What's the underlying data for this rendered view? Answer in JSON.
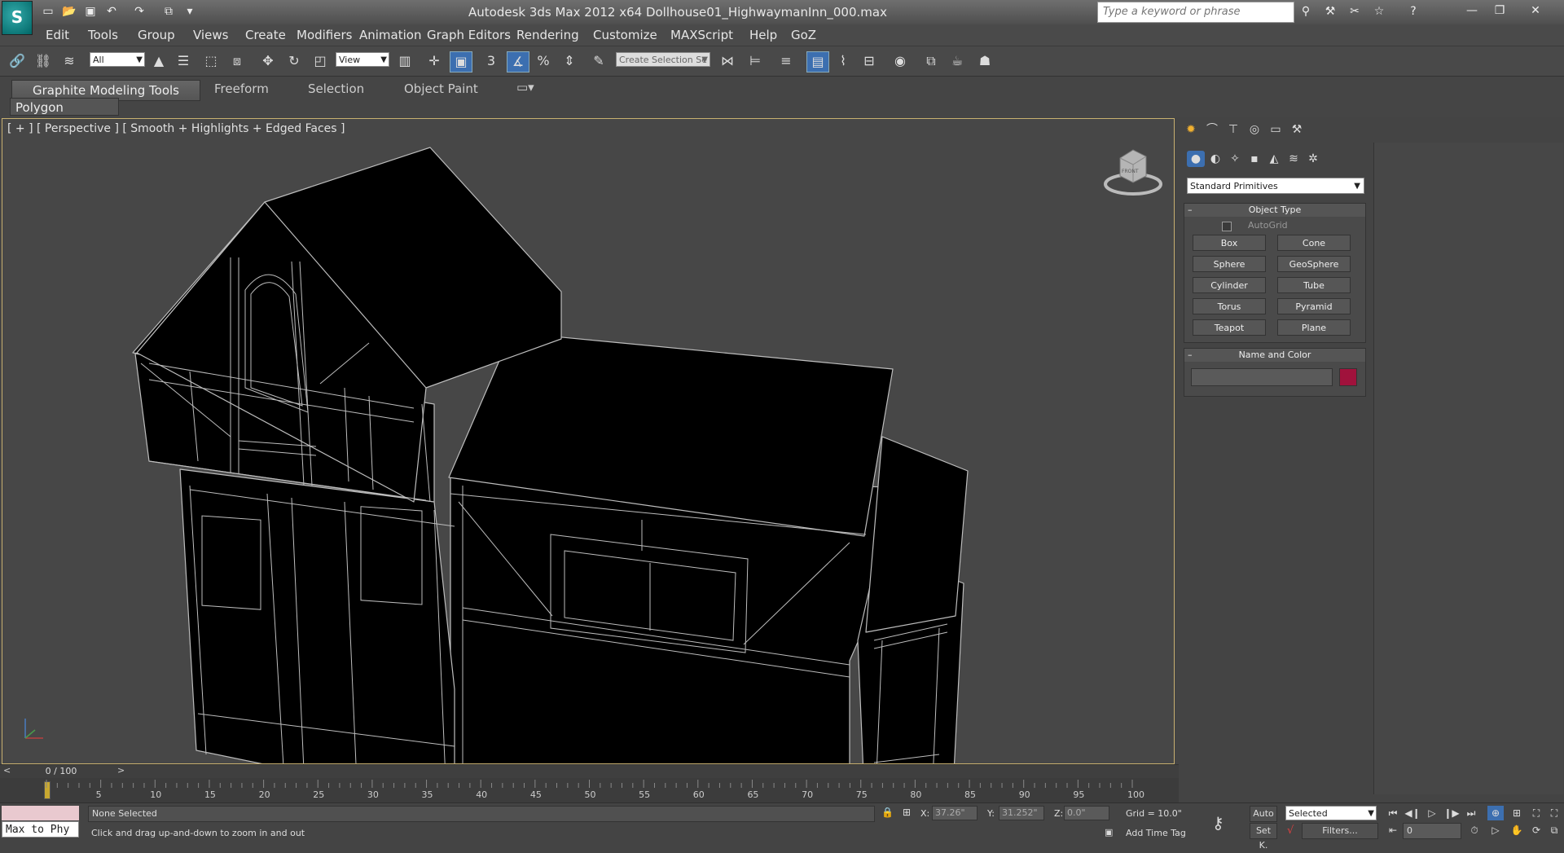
{
  "app": {
    "title": "Autodesk 3ds Max  2012 x64     Dollhouse01_HighwaymanInn_000.max",
    "logo": "S"
  },
  "search": {
    "placeholder": "Type a keyword or phrase"
  },
  "menu": [
    "Edit",
    "Tools",
    "Group",
    "Views",
    "Create",
    "Modifiers",
    "Animation",
    "Graph Editors",
    "Rendering",
    "Customize",
    "MAXScript",
    "Help",
    "GoZ"
  ],
  "toolbar": {
    "filter_value": "All",
    "refcoord_value": "View",
    "selection_set_placeholder": "Create Selection Se",
    "snap_3d": "3",
    "snap_percent": "%"
  },
  "ribbon": {
    "tabs": [
      "Graphite Modeling Tools",
      "Freeform",
      "Selection",
      "Object Paint"
    ],
    "polygon_modeling": "Polygon Modeling"
  },
  "viewport": {
    "label": "[ + ] [ Perspective ] [ Smooth + Highlights + Edged Faces ]",
    "viewcube_face": "FRONT"
  },
  "command_panel": {
    "category": "Standard Primitives",
    "object_type": {
      "title": "Object Type",
      "autogrid": "AutoGrid",
      "buttons": [
        "Box",
        "Cone",
        "Sphere",
        "GeoSphere",
        "Cylinder",
        "Tube",
        "Torus",
        "Pyramid",
        "Teapot",
        "Plane"
      ]
    },
    "name_and_color": {
      "title": "Name and Color",
      "name_value": "",
      "color": "#a0123c"
    }
  },
  "timeline": {
    "frame_counter": "0 / 100",
    "ticks": [
      "5",
      "10",
      "15",
      "20",
      "25",
      "30",
      "35",
      "40",
      "45",
      "50",
      "55",
      "60",
      "65",
      "70",
      "75",
      "80",
      "85",
      "90",
      "95",
      "100"
    ]
  },
  "status": {
    "maxscript_text": "Max to Phy",
    "selection": "None Selected",
    "prompt": "Click and drag up-and-down to zoom in and out",
    "x_label": "X:",
    "x_value": "37.26\"",
    "y_label": "Y:",
    "y_value": "31.252\"",
    "z_label": "Z:",
    "z_value": "0.0\"",
    "grid": "Grid = 10.0\"",
    "add_time_tag": "Add Time Tag",
    "auto_key": "Auto",
    "set_key": "Set K.",
    "key_filter": "Selected",
    "filters": "Filters...",
    "current_frame": "0"
  },
  "colors": {
    "accent": "#3c6fb0",
    "viewport_border": "#c8b070",
    "object_color": "#a0123c"
  }
}
